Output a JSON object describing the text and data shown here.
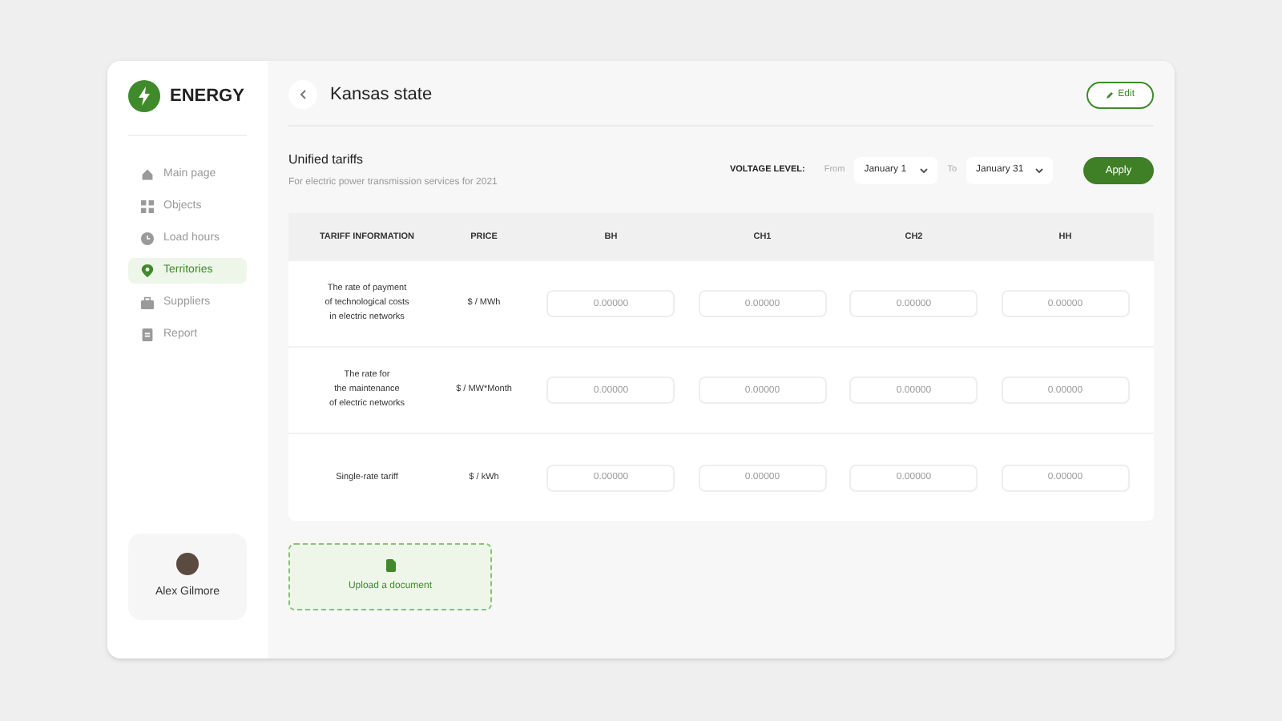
{
  "brand": "ENERGY",
  "sidebar": {
    "items": [
      {
        "label": "Main page",
        "selected": false
      },
      {
        "label": "Objects",
        "selected": false
      },
      {
        "label": "Load hours",
        "selected": false
      },
      {
        "label": "Territories",
        "selected": true
      },
      {
        "label": "Suppliers",
        "selected": false
      },
      {
        "label": "Report",
        "selected": false
      }
    ]
  },
  "user": {
    "name": "Alex Gilmore"
  },
  "header": {
    "title": "Kansas state",
    "edit_button": "Edit"
  },
  "section": {
    "title": "Unified tariffs",
    "subtitle": "For electric power transmission services for 2021"
  },
  "filter": {
    "label": "VOLTAGE LEVEL:",
    "from_label": "From",
    "from_value": "January 1",
    "to_label": "To",
    "to_value": "January 31",
    "apply_button": "Apply"
  },
  "table": {
    "columns": [
      "TARIFF INFORMATION",
      "PRICE",
      "BH",
      "CH1",
      "CH2",
      "HH"
    ],
    "rows": [
      {
        "info": "The rate of payment\nof technological costs\nin electric networks",
        "price": "$ / MWh",
        "inputs": [
          {
            "placeholder": "0.00000"
          },
          {
            "placeholder": "0.00000"
          },
          {
            "placeholder": "0.00000"
          },
          {
            "placeholder": "0.00000"
          }
        ]
      },
      {
        "info": "The rate for\nthe maintenance\nof electric networks",
        "price": "$ / MW*Month",
        "inputs": [
          {
            "placeholder": "0.00000"
          },
          {
            "placeholder": "0.00000"
          },
          {
            "placeholder": "0.00000"
          },
          {
            "placeholder": "0.00000"
          }
        ]
      },
      {
        "info": "Single-rate tariff",
        "price": "$ / kWh",
        "inputs": [
          {
            "placeholder": "0.00000"
          },
          {
            "placeholder": "0.00000"
          },
          {
            "placeholder": "0.00000"
          },
          {
            "placeholder": "0.00000"
          }
        ]
      }
    ]
  },
  "upload": {
    "label": "Upload a document"
  }
}
